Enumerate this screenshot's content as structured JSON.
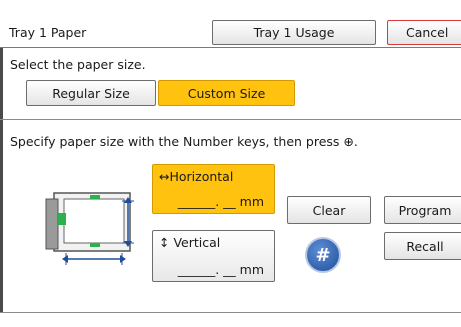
{
  "header": {
    "title": "Tray 1 Paper",
    "usage_button": "Tray 1 Usage",
    "cancel_button": "Cancel"
  },
  "select_size": {
    "prompt": "Select the paper size.",
    "regular_button": "Regular Size",
    "custom_button": "Custom Size"
  },
  "instruction": "Specify paper size with the Number keys, then press ⊕.",
  "horizontal": {
    "title": "↔Horizontal",
    "value": "______. __ mm"
  },
  "vertical": {
    "title": "↕ Vertical",
    "value": "______. __ mm"
  },
  "buttons": {
    "clear": "Clear",
    "program": "Program",
    "recall": "Recall",
    "hash": "#"
  },
  "colors": {
    "accent": "#ffc20e",
    "cancel_border": "#d63a3a",
    "hash_button": "#2f63b3"
  }
}
